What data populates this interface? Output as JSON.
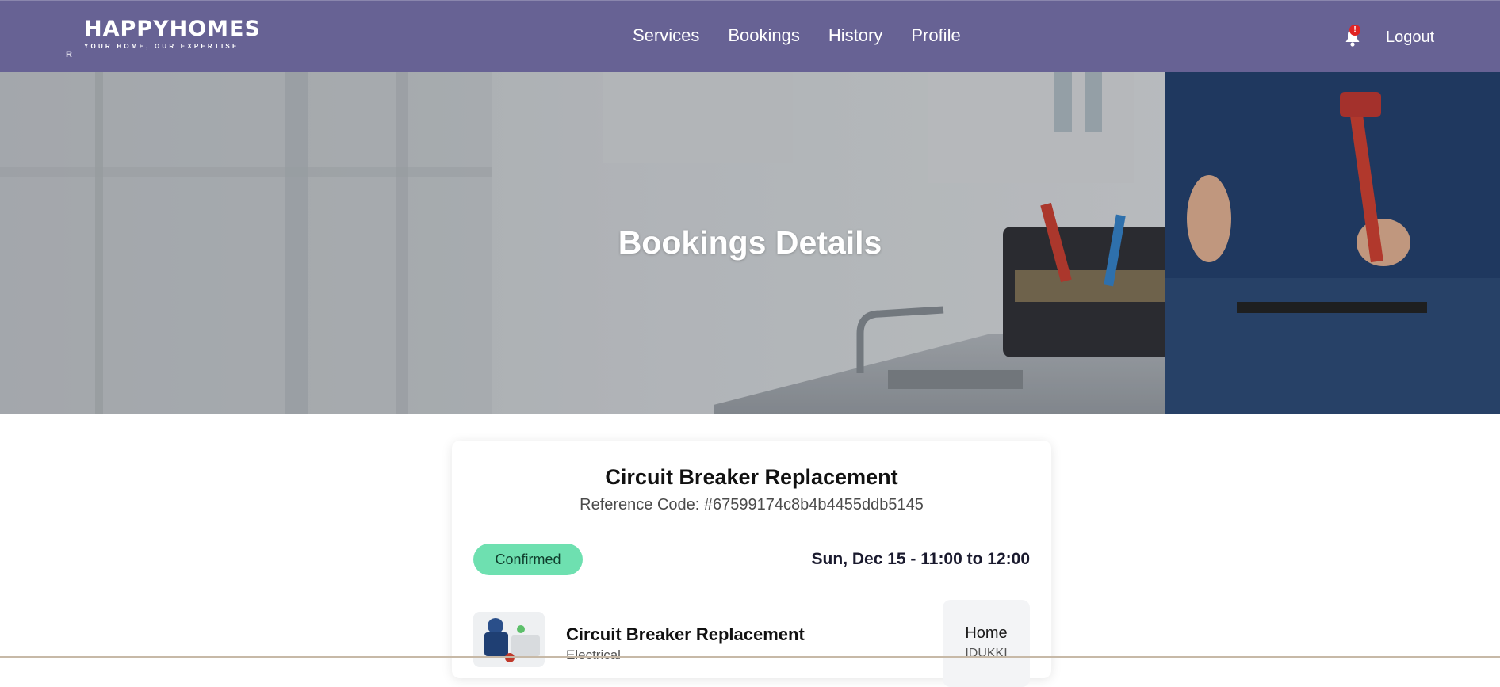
{
  "header": {
    "brand_name": "HAPPYHOMES",
    "brand_tagline": "YOUR HOME, OUR EXPERTISE",
    "brand_mark": "R",
    "nav": [
      "Services",
      "Bookings",
      "History",
      "Profile"
    ],
    "notification_badge": "!",
    "logout_label": "Logout",
    "icons": {
      "notifications": "bell-icon"
    },
    "colors": {
      "navbar_bg": "#676294",
      "badge": "#e02424"
    }
  },
  "hero": {
    "title": "Bookings Details"
  },
  "booking": {
    "title": "Circuit Breaker Replacement",
    "reference": "Reference Code: #67599174c8b4b4455ddb5145",
    "status": "Confirmed",
    "schedule": "Sun, Dec 15 - 11:00 to 12:00",
    "service": {
      "name": "Circuit Breaker Replacement",
      "category": "Electrical"
    },
    "address": {
      "type": "Home",
      "city": "IDUKKI"
    },
    "colors": {
      "status_bg": "#6ee0b0"
    }
  }
}
